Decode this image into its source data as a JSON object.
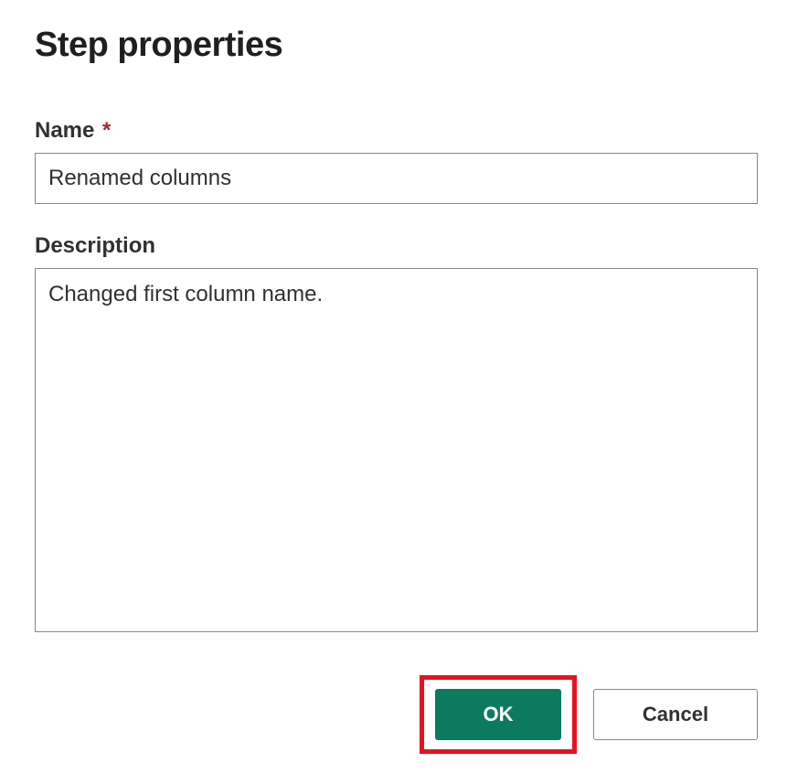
{
  "dialog": {
    "title": "Step properties"
  },
  "fields": {
    "name_label": "Name",
    "name_required_marker": "*",
    "name_value": "Renamed columns",
    "description_label": "Description",
    "description_value": "Changed first column name."
  },
  "buttons": {
    "ok_label": "OK",
    "cancel_label": "Cancel"
  },
  "colors": {
    "primary_button_bg": "#0c7a5f",
    "required_marker": "#a4262c",
    "highlight_border": "#e81123"
  }
}
